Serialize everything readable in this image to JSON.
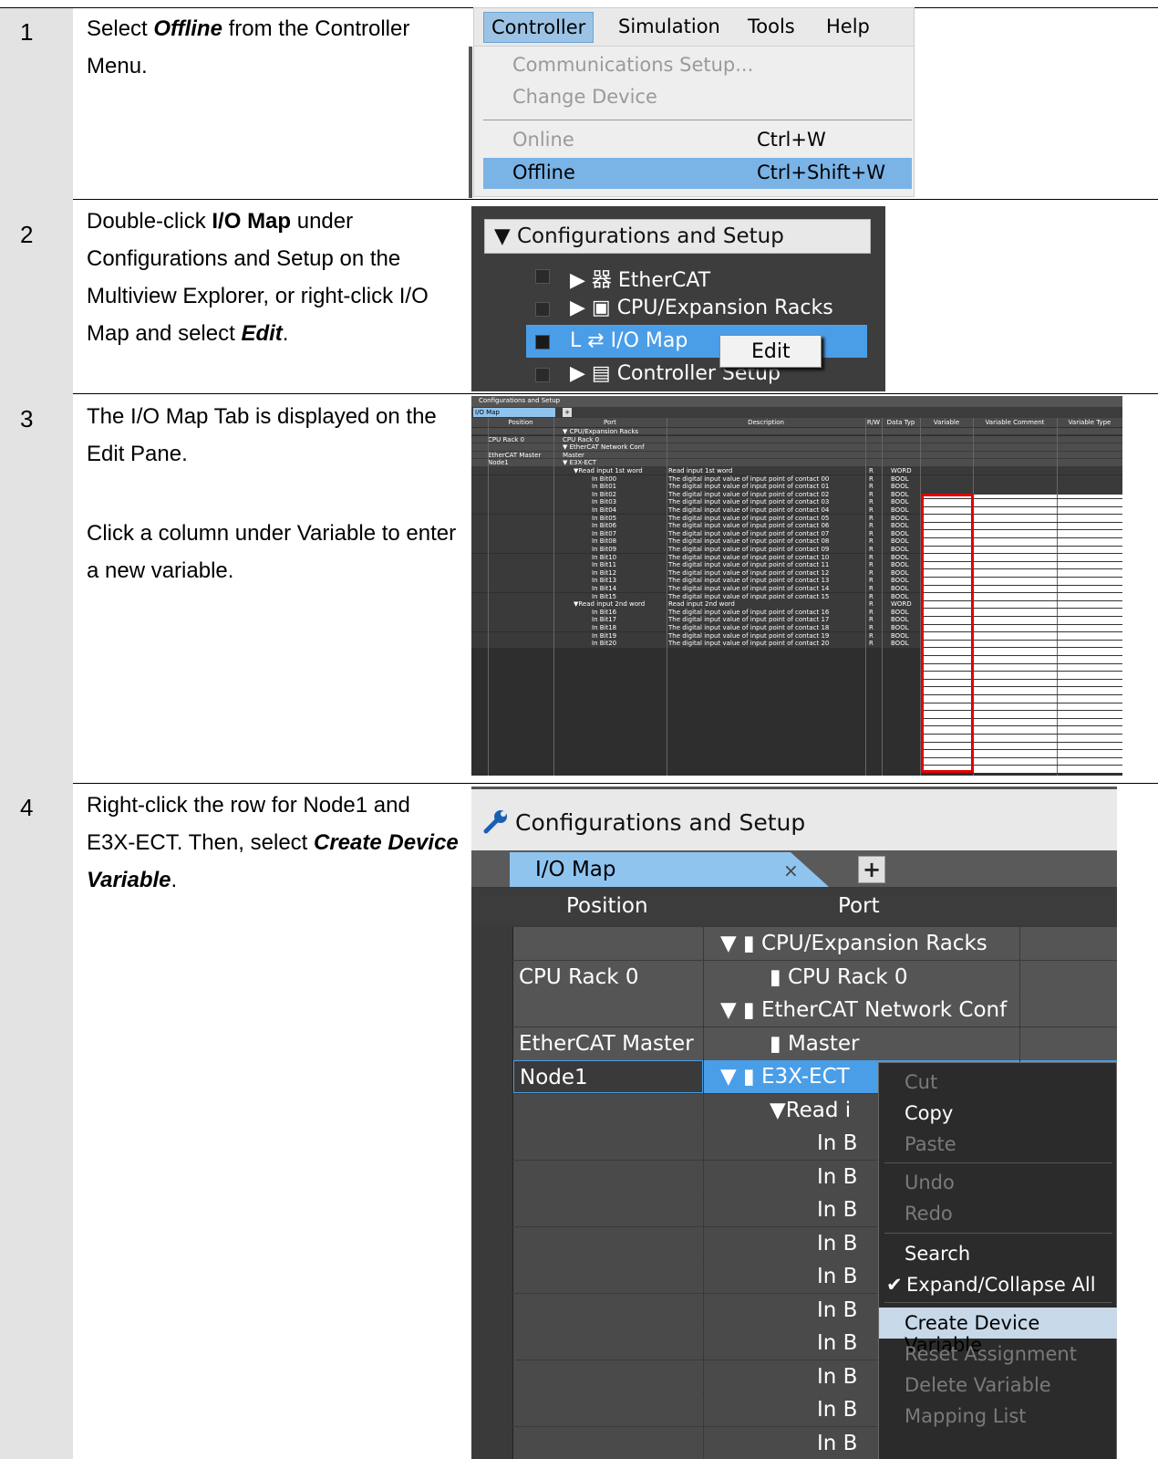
{
  "steps": [
    {
      "num": "1",
      "pre": "Select ",
      "em": "Offline",
      "post": " from the Controller Menu."
    },
    {
      "num": "2",
      "pre": "Double-click ",
      "strong": "I/O Map",
      "mid": " under Configurations and Setup on the Multiview Explorer, or right-click I/O Map and select ",
      "em": "Edit",
      "post": "."
    },
    {
      "num": "3",
      "line1": "The I/O Map Tab is displayed on the Edit Pane.",
      "line2": "Click a column under Variable to enter a new variable."
    },
    {
      "num": "4",
      "text": "Right-click the row for Node1 and E3X-ECT. Then, select ",
      "em": "Create Device Variable",
      "post": "."
    }
  ],
  "menu1": {
    "bar": [
      "Controller",
      "Simulation",
      "Tools",
      "Help"
    ],
    "items": [
      {
        "label": "Communications Setup...",
        "key": ""
      },
      {
        "label": "Change Device",
        "key": ""
      },
      {
        "label": "Online",
        "key": "Ctrl+W"
      },
      {
        "label": "Offline",
        "key": "Ctrl+Shift+W"
      }
    ]
  },
  "tree2": {
    "header": "▼ Configurations and Setup",
    "nodes": [
      "▶ 器 EtherCAT",
      "▶ ▣ CPU/Expansion Racks",
      "L ⇄ I/O Map",
      "▶ ▤ Controller Setup"
    ],
    "context": "Edit"
  },
  "grid3": {
    "title": "Configurations and Setup",
    "tab": "I/O Map",
    "headers": [
      "Position",
      "Port",
      "Description",
      "R/W",
      "Data Typ",
      "Variable",
      "Variable Comment",
      "Variable Type"
    ],
    "rows": [
      {
        "pos": "",
        "port": "▼ CPU/Expansion Racks",
        "desc": "",
        "rw": "",
        "dt": ""
      },
      {
        "pos": "CPU Rack 0",
        "port": "CPU Rack 0",
        "desc": "",
        "rw": "",
        "dt": ""
      },
      {
        "pos": "",
        "port": "▼ EtherCAT Network Conf",
        "desc": "",
        "rw": "",
        "dt": ""
      },
      {
        "pos": "EtherCAT Master",
        "port": "Master",
        "desc": "",
        "rw": "",
        "dt": ""
      },
      {
        "pos": "Node1",
        "port": "▼  E3X-ECT",
        "desc": "",
        "rw": "",
        "dt": ""
      },
      {
        "pos": "",
        "port": "▼Read input 1st word",
        "desc": "Read input 1st word",
        "rw": "R",
        "dt": "WORD"
      },
      {
        "pos": "",
        "port": "In Bit00",
        "desc": "The digital input value of input point of contact 00",
        "rw": "R",
        "dt": "BOOL"
      },
      {
        "pos": "",
        "port": "In Bit01",
        "desc": "The digital input value of input point of contact 01",
        "rw": "R",
        "dt": "BOOL"
      },
      {
        "pos": "",
        "port": "In Bit02",
        "desc": "The digital input value of input point of contact 02",
        "rw": "R",
        "dt": "BOOL"
      },
      {
        "pos": "",
        "port": "In Bit03",
        "desc": "The digital input value of input point of contact 03",
        "rw": "R",
        "dt": "BOOL"
      },
      {
        "pos": "",
        "port": "In Bit04",
        "desc": "The digital input value of input point of contact 04",
        "rw": "R",
        "dt": "BOOL"
      },
      {
        "pos": "",
        "port": "In Bit05",
        "desc": "The digital input value of input point of contact 05",
        "rw": "R",
        "dt": "BOOL"
      },
      {
        "pos": "",
        "port": "In Bit06",
        "desc": "The digital input value of input point of contact 06",
        "rw": "R",
        "dt": "BOOL"
      },
      {
        "pos": "",
        "port": "In Bit07",
        "desc": "The digital input value of input point of contact 07",
        "rw": "R",
        "dt": "BOOL"
      },
      {
        "pos": "",
        "port": "In Bit08",
        "desc": "The digital input value of input point of contact 08",
        "rw": "R",
        "dt": "BOOL"
      },
      {
        "pos": "",
        "port": "In Bit09",
        "desc": "The digital input value of input point of contact 09",
        "rw": "R",
        "dt": "BOOL"
      },
      {
        "pos": "",
        "port": "In Bit10",
        "desc": "The digital input value of input point of contact 10",
        "rw": "R",
        "dt": "BOOL"
      },
      {
        "pos": "",
        "port": "In Bit11",
        "desc": "The digital input value of input point of contact 11",
        "rw": "R",
        "dt": "BOOL"
      },
      {
        "pos": "",
        "port": "In Bit12",
        "desc": "The digital input value of input point of contact 12",
        "rw": "R",
        "dt": "BOOL"
      },
      {
        "pos": "",
        "port": "In Bit13",
        "desc": "The digital input value of input point of contact 13",
        "rw": "R",
        "dt": "BOOL"
      },
      {
        "pos": "",
        "port": "In Bit14",
        "desc": "The digital input value of input point of contact 14",
        "rw": "R",
        "dt": "BOOL"
      },
      {
        "pos": "",
        "port": "In Bit15",
        "desc": "The digital input value of input point of contact 15",
        "rw": "R",
        "dt": "BOOL"
      },
      {
        "pos": "",
        "port": "▼Read input 2nd word",
        "desc": "Read input 2nd word",
        "rw": "R",
        "dt": "WORD"
      },
      {
        "pos": "",
        "port": "In Bit16",
        "desc": "The digital input value of input point of contact 16",
        "rw": "R",
        "dt": "BOOL"
      },
      {
        "pos": "",
        "port": "In Bit17",
        "desc": "The digital input value of input point of contact 17",
        "rw": "R",
        "dt": "BOOL"
      },
      {
        "pos": "",
        "port": "In Bit18",
        "desc": "The digital input value of input point of contact 18",
        "rw": "R",
        "dt": "BOOL"
      },
      {
        "pos": "",
        "port": "In Bit19",
        "desc": "The digital input value of input point of contact 19",
        "rw": "R",
        "dt": "BOOL"
      },
      {
        "pos": "",
        "port": "In Bit20",
        "desc": "The digital input value of input point of contact 20",
        "rw": "R",
        "dt": "BOOL"
      }
    ]
  },
  "shot4": {
    "title": "Configurations and Setup",
    "tab": "I/O Map",
    "tab_close": "×",
    "plus": "+",
    "headers": {
      "position": "Position",
      "port": "Port"
    },
    "rows": [
      {
        "pos": "",
        "port": "▼ ▮ CPU/Expansion Racks"
      },
      {
        "pos": "CPU Rack 0",
        "port": "▮ CPU Rack 0"
      },
      {
        "pos": "",
        "port": "▼ ▮ EtherCAT Network Conf"
      },
      {
        "pos": "EtherCAT Master",
        "port": "▮ Master"
      },
      {
        "pos": "Node1",
        "port": "▼  ▮ E3X-ECT"
      },
      {
        "pos": "",
        "port": "▼Read i"
      },
      {
        "pos": "",
        "port": "In B"
      },
      {
        "pos": "",
        "port": "In B"
      },
      {
        "pos": "",
        "port": "In B"
      },
      {
        "pos": "",
        "port": "In B"
      },
      {
        "pos": "",
        "port": "In B"
      },
      {
        "pos": "",
        "port": "In B"
      },
      {
        "pos": "",
        "port": "In B"
      },
      {
        "pos": "",
        "port": "In B"
      },
      {
        "pos": "",
        "port": "In B"
      },
      {
        "pos": "",
        "port": "In B"
      }
    ],
    "context": [
      {
        "label": "Cut",
        "state": "dis"
      },
      {
        "label": "Copy",
        "state": "en"
      },
      {
        "label": "Paste",
        "state": "dis"
      },
      {
        "label": "Undo",
        "state": "dis"
      },
      {
        "label": "Redo",
        "state": "dis"
      },
      {
        "label": "Search",
        "state": "en"
      },
      {
        "label": "Expand/Collapse All",
        "state": "en"
      },
      {
        "label": "Create Device Variable",
        "state": "hov"
      },
      {
        "label": "Reset Assignment",
        "state": "dis"
      },
      {
        "label": "Delete Variable",
        "state": "dis"
      },
      {
        "label": "Mapping List",
        "state": "dis"
      }
    ]
  }
}
